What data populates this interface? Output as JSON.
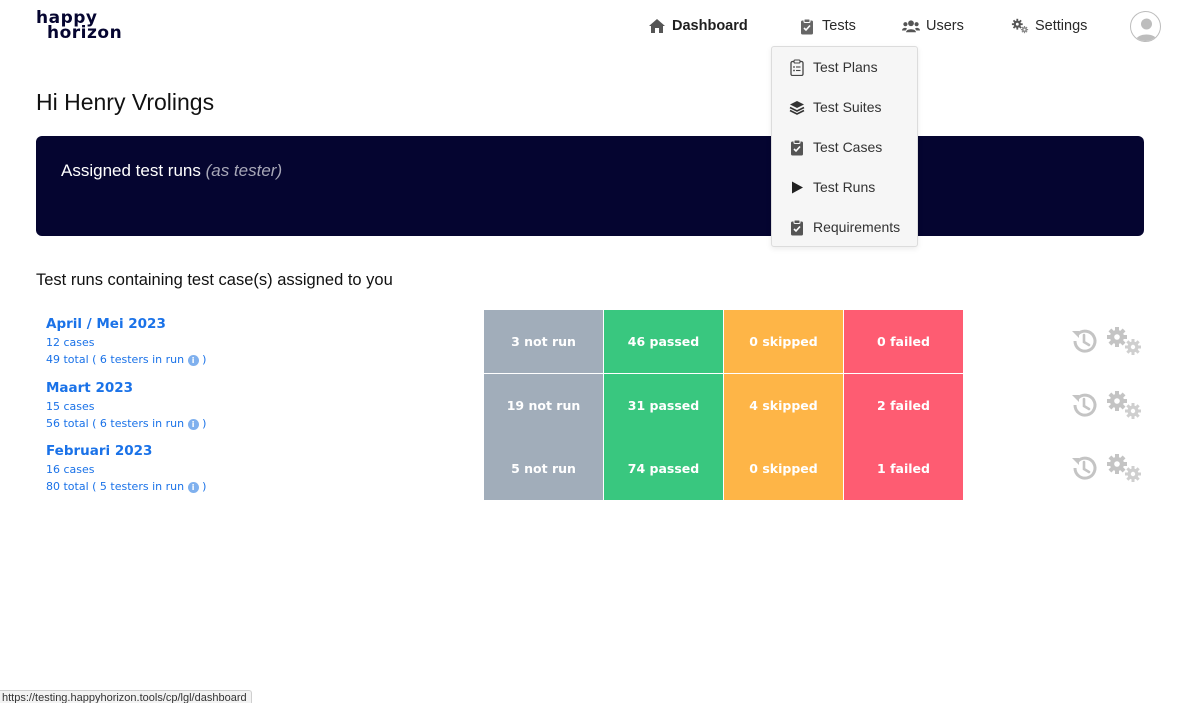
{
  "brand": {
    "line1": "happy",
    "line2": "horizon"
  },
  "nav": {
    "dashboard": {
      "label": "Dashboard",
      "icon": "home-icon"
    },
    "tests": {
      "label": "Tests",
      "icon": "clipboard-icon"
    },
    "users": {
      "label": "Users",
      "icon": "users-icon"
    },
    "settings": {
      "label": "Settings",
      "icon": "gears-icon"
    }
  },
  "dropdown": {
    "items": [
      {
        "label": "Test Plans",
        "icon": "clipboard-list-icon"
      },
      {
        "label": "Test Suites",
        "icon": "layers-icon"
      },
      {
        "label": "Test Cases",
        "icon": "clipboard-check-icon"
      },
      {
        "label": "Test Runs",
        "icon": "play-icon"
      },
      {
        "label": "Requirements",
        "icon": "clipboard-check-icon"
      }
    ]
  },
  "greeting": "Hi Henry Vrolings",
  "banner": {
    "title": "Assigned test runs",
    "subtitle": "(as tester)"
  },
  "section_title": "Test runs containing test case(s) assigned to you",
  "runs": [
    {
      "name": "April / Mei 2023",
      "cases": "12 cases",
      "total_prefix": "49 total ( 6 testers in run",
      "total_suffix": ")",
      "not_run": "3 not run",
      "passed": "46 passed",
      "skipped": "0 skipped",
      "failed": "0 failed"
    },
    {
      "name": "Maart 2023",
      "cases": "15 cases",
      "total_prefix": "56 total ( 6 testers in run",
      "total_suffix": ")",
      "not_run": "19 not run",
      "passed": "31 passed",
      "skipped": "4 skipped",
      "failed": "2 failed"
    },
    {
      "name": "Februari 2023",
      "cases": "16 cases",
      "total_prefix": "80 total ( 5 testers in run",
      "total_suffix": ")",
      "not_run": "5 not run",
      "passed": "74 passed",
      "skipped": "0 skipped",
      "failed": "1 failed"
    }
  ],
  "info_glyph": "i",
  "colors": {
    "navy": "#050530",
    "link": "#1a72e8",
    "not_run": "#a1adba",
    "passed": "#39c77f",
    "skipped": "#feb547",
    "failed": "#fe5c72",
    "action_icon": "#c4c4c4"
  },
  "statusbar": {
    "url": "https://testing.happyhorizon.tools/cp/lgl/dashboard"
  }
}
